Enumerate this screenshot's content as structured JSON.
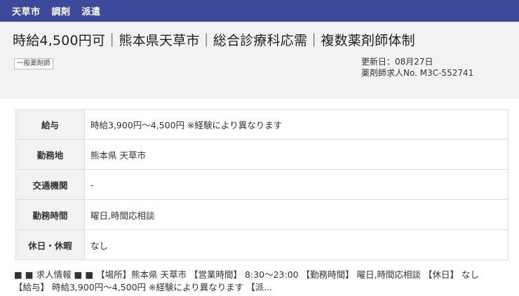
{
  "header": {
    "tags": [
      "天草市",
      "調剤",
      "派遣"
    ]
  },
  "summary": {
    "title": "時給4,500円可｜熊本県天草市｜総合診療科応需｜複数薬剤師体制",
    "badge": "一般薬剤師",
    "updated": "更新日：08月27日",
    "job_number": "薬剤師求人No. M3C-552741"
  },
  "table": {
    "rows": [
      {
        "label": "給与",
        "value": "時給3,900円～4,500円 ※経験により異なります"
      },
      {
        "label": "勤務地",
        "value": "熊本県 天草市"
      },
      {
        "label": "交通機関",
        "value": "-"
      },
      {
        "label": "勤務時間",
        "value": "曜日,時間応相談"
      },
      {
        "label": "休日・休暇",
        "value": "なし"
      }
    ]
  },
  "description": {
    "line1": "■ ■ 求人情報 ■ ■ 【場所】熊本県 天草市 【営業時間】 8:30～23:00 【勤務時間】 曜日,時間応相談 【休日】 なし",
    "line2": "【給与】 時給3,900円～4,500円 ※経験により異なります 【派..."
  }
}
